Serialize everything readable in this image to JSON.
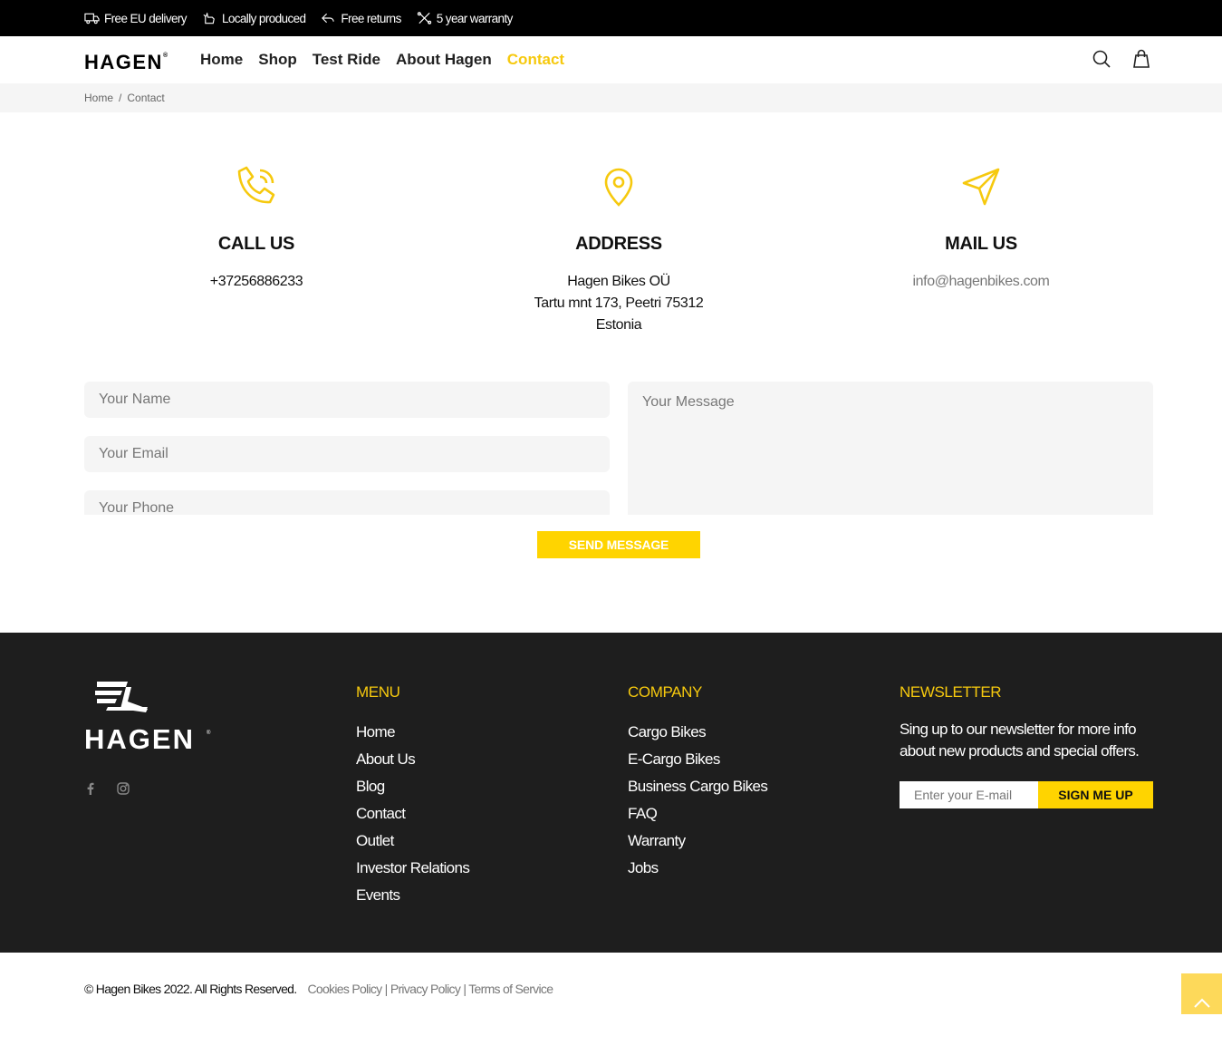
{
  "topbar": {
    "items": [
      "Free EU delivery",
      "Locally produced",
      "Free returns",
      "5 year warranty"
    ]
  },
  "header": {
    "logo": "HAGEN",
    "nav": [
      "Home",
      "Shop",
      "Test Ride",
      "About Hagen",
      "Contact"
    ],
    "active_nav": "Contact"
  },
  "breadcrumb": {
    "home": "Home",
    "separator": "/",
    "current": "Contact"
  },
  "contact": {
    "call": {
      "title": "CALL US",
      "value": "+37256886233"
    },
    "address": {
      "title": "ADDRESS",
      "line1": "Hagen Bikes OÜ",
      "line2": "Tartu mnt 173, Peetri 75312",
      "line3": "Estonia"
    },
    "mail": {
      "title": "MAIL US",
      "value": "info@hagenbikes.com"
    }
  },
  "form": {
    "name_placeholder": "Your Name",
    "email_placeholder": "Your Email",
    "phone_placeholder": "Your Phone",
    "message_placeholder": "Your Message",
    "submit": "SEND MESSAGE"
  },
  "footer": {
    "logo": "HAGEN",
    "menu": {
      "title": "MENU",
      "items": [
        "Home",
        "About Us",
        "Blog",
        "Contact",
        "Outlet",
        "Investor Relations",
        "Events"
      ]
    },
    "company": {
      "title": "COMPANY",
      "items": [
        "Cargo Bikes",
        "E-Cargo Bikes",
        "Business Cargo Bikes",
        "FAQ",
        "Warranty",
        "Jobs"
      ]
    },
    "newsletter": {
      "title": "NEWSLETTER",
      "text": "Sing up to our newsletter for more info about new products and special offers.",
      "placeholder": "Enter your E-mail",
      "button": "SIGN ME UP"
    }
  },
  "bottom": {
    "copyright": "© Hagen Bikes 2022. All Rights Reserved.",
    "cookies": "Cookies Policy",
    "privacy": "Privacy Policy",
    "terms": "Terms of Service",
    "sep": "|"
  },
  "colors": {
    "accent": "#ffd400",
    "dark": "#1e1e1e"
  }
}
